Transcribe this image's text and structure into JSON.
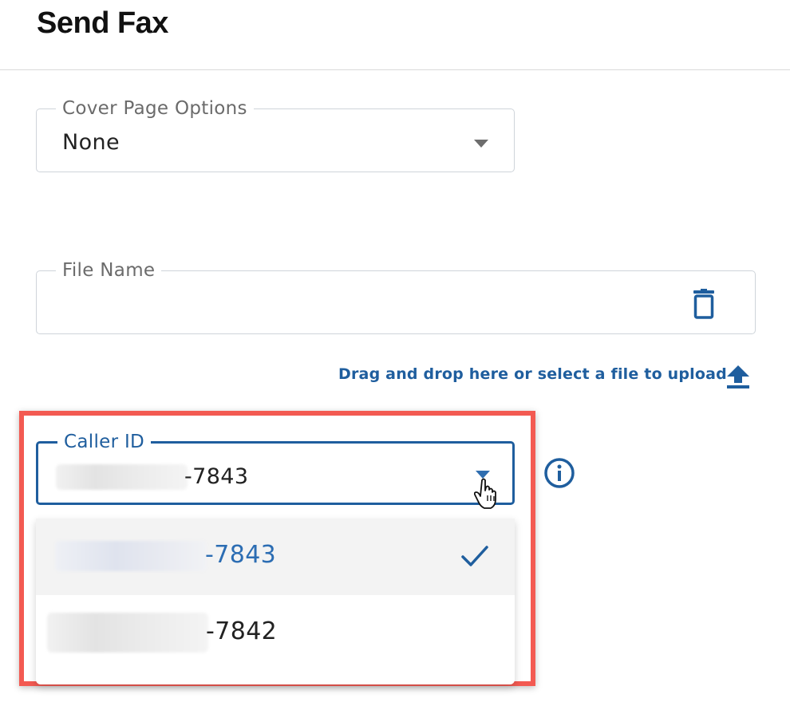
{
  "page": {
    "title": "Send Fax"
  },
  "cover_page": {
    "label": "Cover Page Options",
    "value": "None"
  },
  "file_name": {
    "label": "File Name",
    "value": ""
  },
  "upload": {
    "text": "Drag and drop here or select a file to upload"
  },
  "caller_id": {
    "label": "Caller ID",
    "value_suffix": "-7843",
    "options": [
      {
        "suffix": "-7843",
        "selected": true
      },
      {
        "suffix": "-7842",
        "selected": false
      }
    ]
  },
  "colors": {
    "accent": "#1f5e9e",
    "highlight_border": "#f35a52",
    "selected_text": "#2c6db3"
  },
  "icons": [
    "trash-icon",
    "upload-icon",
    "info-icon",
    "chevron-down-icon",
    "checkmark-icon",
    "hand-cursor-icon"
  ]
}
